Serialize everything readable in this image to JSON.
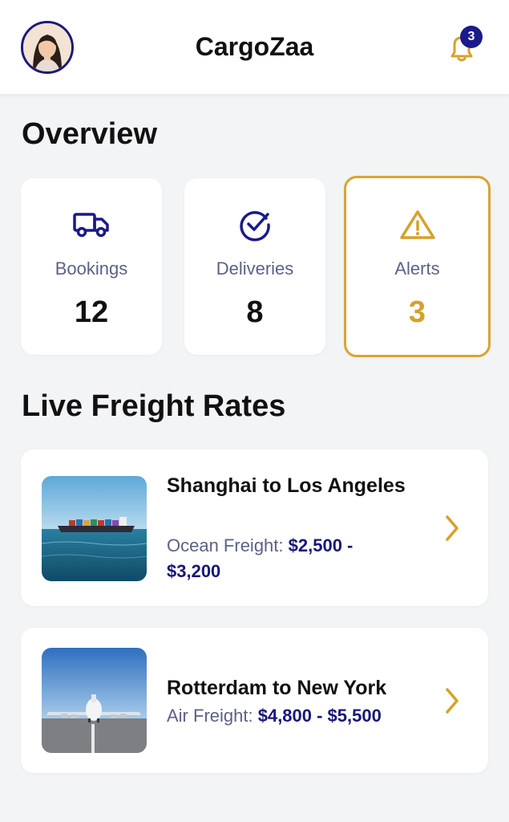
{
  "header": {
    "title": "CargoZaa",
    "notification_count": "3",
    "avatar": "user-avatar"
  },
  "overview": {
    "title": "Overview",
    "cards": [
      {
        "icon": "truck-icon",
        "label": "Bookings",
        "value": "12"
      },
      {
        "icon": "check-circle-icon",
        "label": "Deliveries",
        "value": "8"
      },
      {
        "icon": "warning-triangle-icon",
        "label": "Alerts",
        "value": "3"
      }
    ]
  },
  "rates": {
    "title": "Live Freight Rates",
    "items": [
      {
        "route": "Shanghai to Los Angeles",
        "mode": "Ocean Freight:",
        "price": "$2,500 - $3,200",
        "image": "cargo-ship-image"
      },
      {
        "route": "Rotterdam to New York",
        "mode": "Air Freight:",
        "price": "$4,800 - $5,500",
        "image": "cargo-plane-image"
      }
    ]
  },
  "colors": {
    "accent_gold": "#d6a12c",
    "navy": "#1a1a7a",
    "muted_text": "#5d6186",
    "background": "#f3f4f6"
  }
}
